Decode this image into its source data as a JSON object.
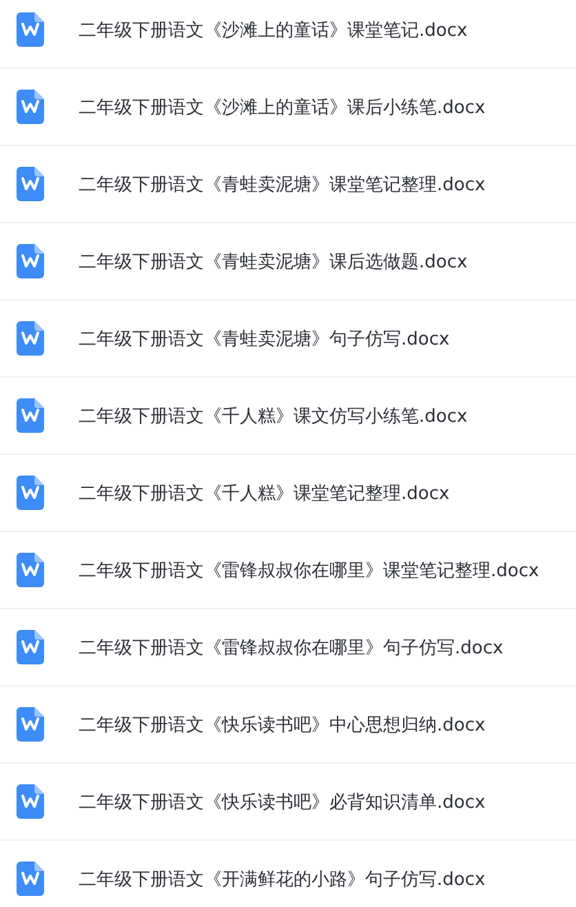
{
  "files": [
    {
      "name": "二年级下册语文《沙滩上的童话》课堂笔记.docx",
      "kind": "word"
    },
    {
      "name": "二年级下册语文《沙滩上的童话》课后小练笔.docx",
      "kind": "word"
    },
    {
      "name": "二年级下册语文《青蛙卖泥塘》课堂笔记整理.docx",
      "kind": "word"
    },
    {
      "name": "二年级下册语文《青蛙卖泥塘》课后选做题.docx",
      "kind": "word"
    },
    {
      "name": "二年级下册语文《青蛙卖泥塘》句子仿写.docx",
      "kind": "word"
    },
    {
      "name": "二年级下册语文《千人糕》课文仿写小练笔.docx",
      "kind": "word"
    },
    {
      "name": "二年级下册语文《千人糕》课堂笔记整理.docx",
      "kind": "word"
    },
    {
      "name": "二年级下册语文《雷锋叔叔你在哪里》课堂笔记整理.docx",
      "kind": "word"
    },
    {
      "name": "二年级下册语文《雷锋叔叔你在哪里》句子仿写.docx",
      "kind": "word"
    },
    {
      "name": "二年级下册语文《快乐读书吧》中心思想归纳.docx",
      "kind": "word"
    },
    {
      "name": "二年级下册语文《快乐读书吧》必背知识清单.docx",
      "kind": "word"
    },
    {
      "name": "二年级下册语文《开满鲜花的小路》句子仿写.docx",
      "kind": "word"
    }
  ]
}
